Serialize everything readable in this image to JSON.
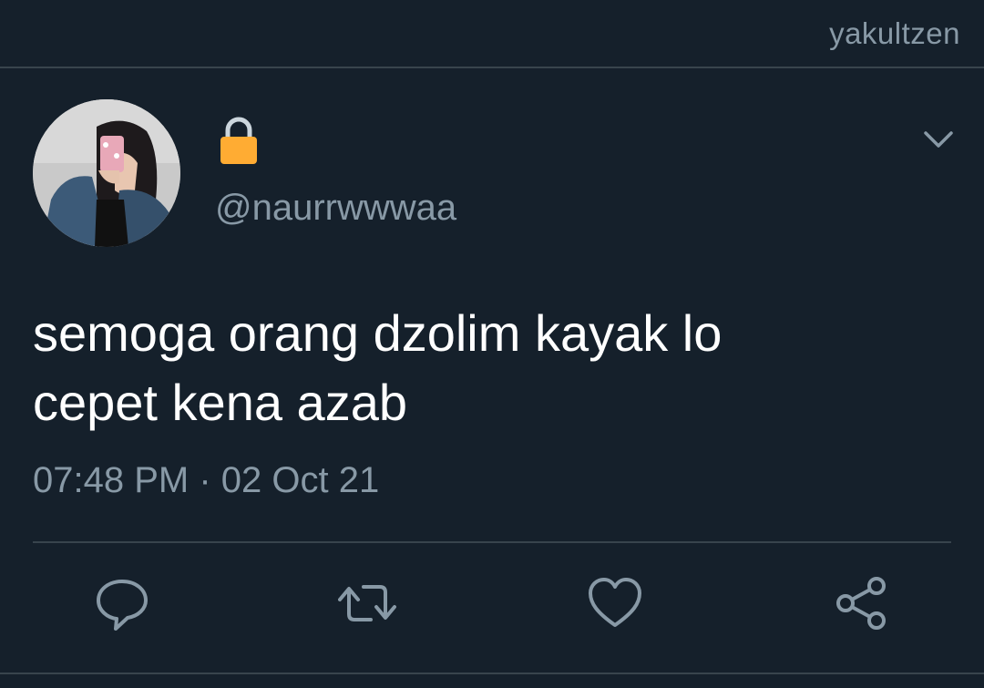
{
  "watermark": "yakultzen",
  "author": {
    "display_name_icon": "lock-icon",
    "handle": "@naurrwwwaa"
  },
  "tweet": {
    "text_line1": "semoga orang dzolim kayak lo",
    "text_line2": "cepet kena azab",
    "time": "07:48 PM",
    "separator": "·",
    "date": "02 Oct 21"
  },
  "actions": [
    "reply-icon",
    "retweet-icon",
    "like-icon",
    "share-icon"
  ],
  "colors": {
    "background": "#15202b",
    "secondary_text": "#8899a6",
    "divider": "#38444d",
    "primary_text": "#ffffff",
    "lock_body": "#ffac33",
    "lock_shackle": "#ccd6dd"
  }
}
